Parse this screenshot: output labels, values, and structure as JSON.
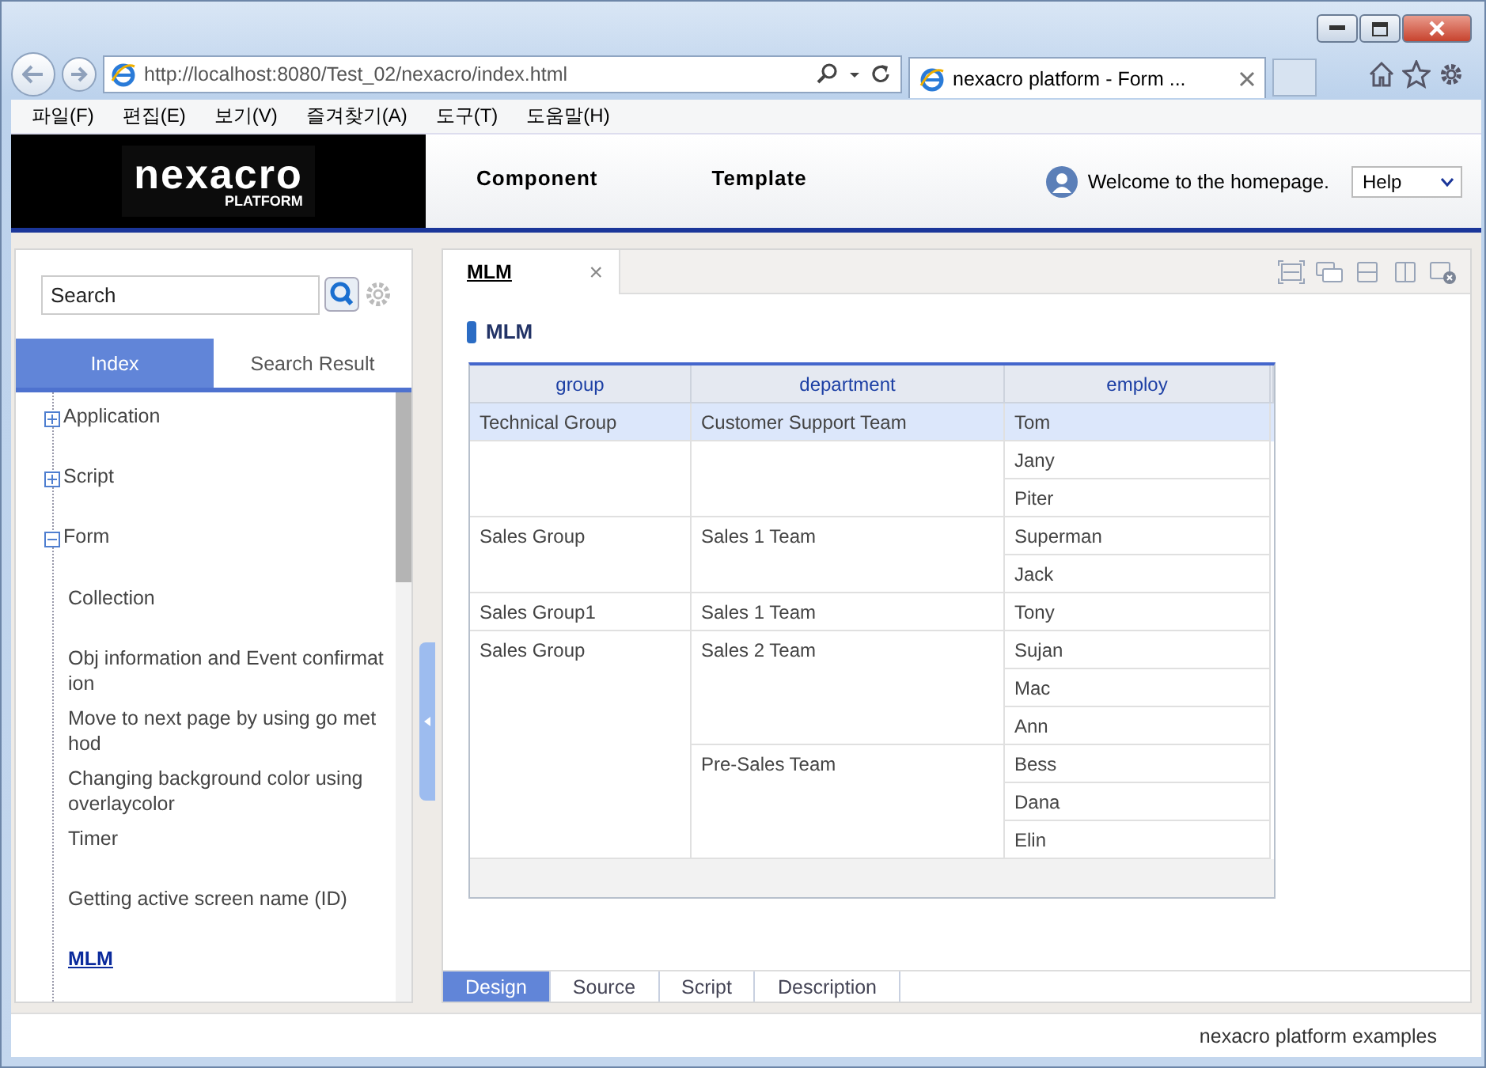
{
  "browser": {
    "url": "http://localhost:8080/Test_02/nexacro/index.html",
    "tab_title": "nexacro platform - Form ...",
    "menu": [
      "파일(F)",
      "편집(E)",
      "보기(V)",
      "즐겨찾기(A)",
      "도구(T)",
      "도움말(H)"
    ]
  },
  "header": {
    "logo": {
      "word": "nexacro",
      "sub": "PLATFORM"
    },
    "nav": [
      "Component",
      "Template"
    ],
    "welcome": "Welcome to the homepage.",
    "help": "Help"
  },
  "sidebar": {
    "search": {
      "value": "Search"
    },
    "tabs": [
      {
        "label": "Index",
        "selected": true
      },
      {
        "label": "Search Result",
        "selected": false
      }
    ],
    "tree": [
      {
        "label": "Application",
        "expanded": false
      },
      {
        "label": "Script",
        "expanded": false
      },
      {
        "label": "Form",
        "expanded": true,
        "children": [
          {
            "label": "Collection",
            "selected": false
          },
          {
            "label": "Obj information and Event confirmat ion",
            "selected": false
          },
          {
            "label": "Move to next page by using go met hod",
            "selected": false
          },
          {
            "label": "Changing background color using overlaycolor",
            "selected": false
          },
          {
            "label": "Timer",
            "selected": false
          },
          {
            "label": "Getting active screen name (ID)",
            "selected": false
          },
          {
            "label": "MLM",
            "selected": true
          }
        ]
      }
    ]
  },
  "workspace": {
    "tab": {
      "label": "MLM",
      "close": "×"
    },
    "title": "MLM",
    "grid": {
      "columns": [
        "group",
        "department",
        "employ"
      ],
      "groups": [
        {
          "name": "Technical Group",
          "departments": [
            {
              "name": "Customer Support Team",
              "employees": [
                {
                  "name": "Tom",
                  "selected": true
                }
              ]
            }
          ]
        },
        {
          "departments": [
            {
              "employees": [
                {
                  "name": "Jany",
                  "selected": false
                },
                {
                  "name": "Piter",
                  "selected": false
                }
              ]
            }
          ]
        },
        {
          "name": "Sales Group",
          "departments": [
            {
              "name": "Sales 1 Team",
              "employees": [
                {
                  "name": "Superman",
                  "selected": false
                },
                {
                  "name": "Jack",
                  "selected": false
                }
              ]
            }
          ]
        },
        {
          "name": "Sales Group1",
          "departments": [
            {
              "name": "Sales 1 Team",
              "employees": [
                {
                  "name": "Tony",
                  "selected": false
                }
              ]
            }
          ]
        },
        {
          "name": "Sales Group",
          "departments": [
            {
              "name": "Sales 2 Team",
              "employees": [
                {
                  "name": "Sujan",
                  "selected": false
                },
                {
                  "name": "Mac",
                  "selected": false
                },
                {
                  "name": "Ann",
                  "selected": false
                }
              ]
            },
            {
              "name": "Pre-Sales Team",
              "employees": [
                {
                  "name": "Bess",
                  "selected": false
                },
                {
                  "name": "Dana",
                  "selected": false
                },
                {
                  "name": "Elin",
                  "selected": false
                }
              ]
            }
          ]
        }
      ]
    },
    "bottom_tabs": [
      {
        "label": "Design",
        "selected": true
      },
      {
        "label": "Source",
        "selected": false
      },
      {
        "label": "Script",
        "selected": false
      },
      {
        "label": "Description",
        "selected": false
      }
    ]
  },
  "footer": "nexacro platform examples"
}
